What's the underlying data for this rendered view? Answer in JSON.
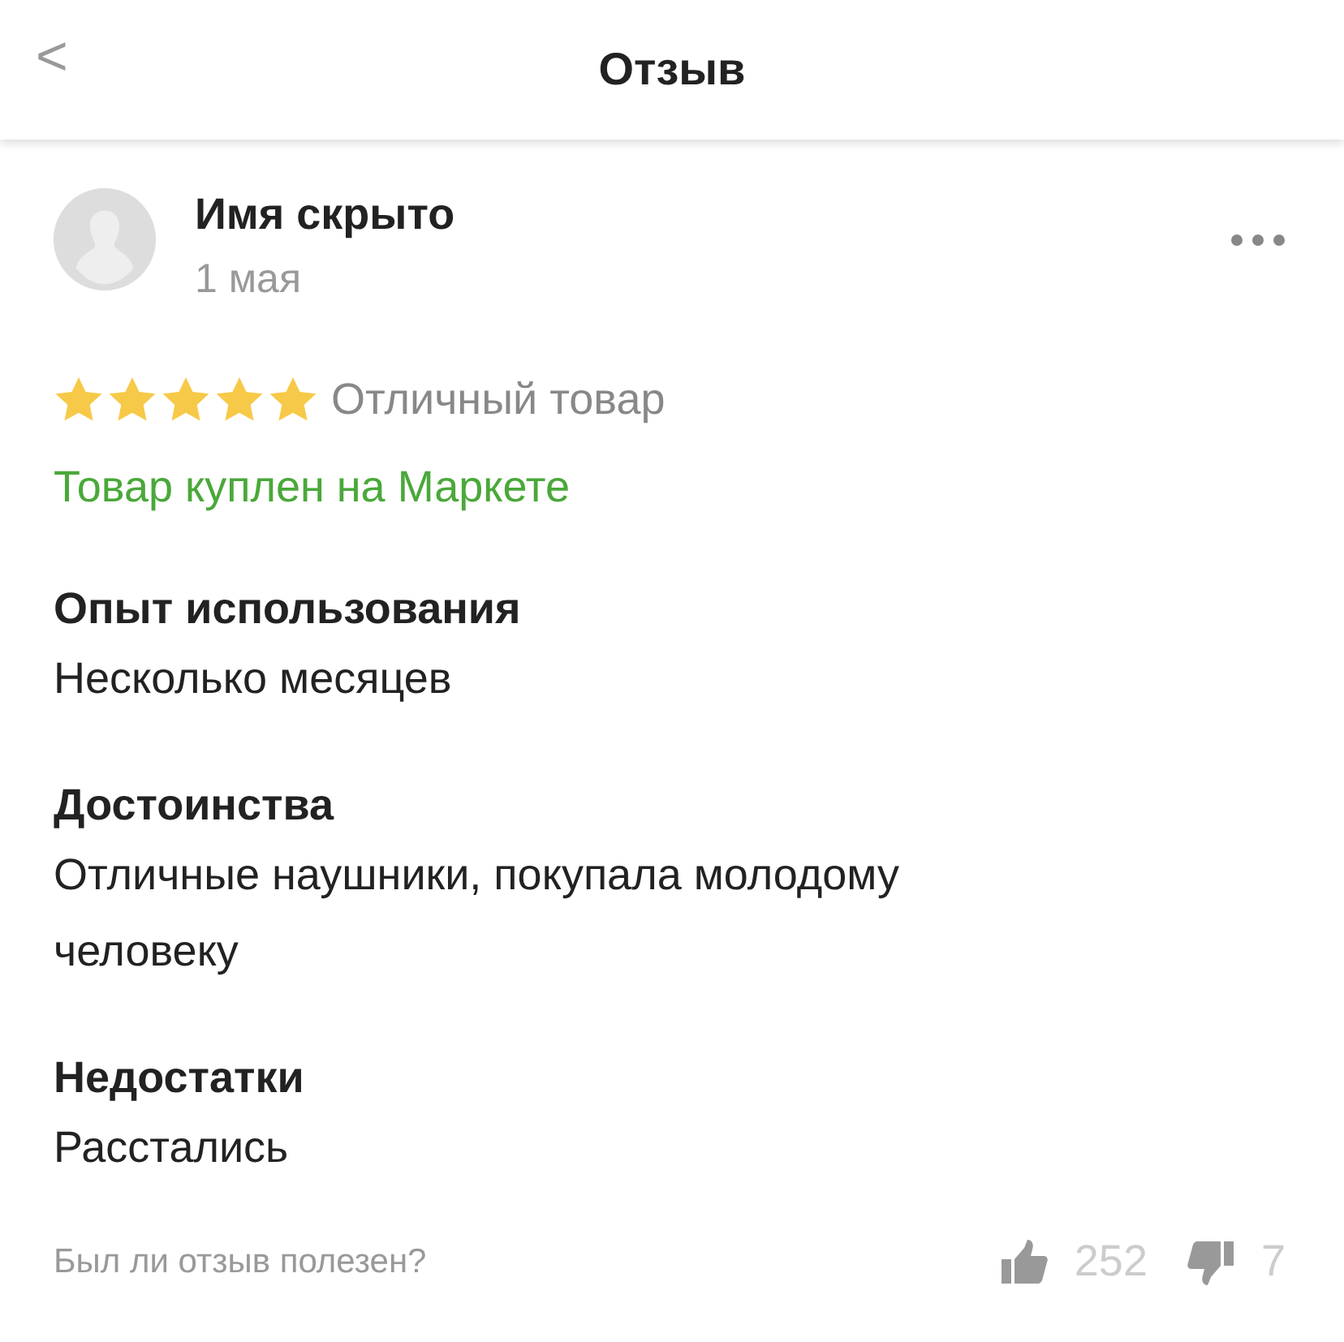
{
  "header": {
    "back": "<",
    "title": "Отзыв"
  },
  "review": {
    "author": "Имя скрыто",
    "date": "1 мая",
    "stars": 5,
    "rating_text": "Отличный товар",
    "purchase_note": "Товар куплен на Маркете",
    "sections": [
      {
        "heading": "Опыт использования",
        "text": "Несколько месяцев"
      },
      {
        "heading": "Достоинства",
        "text": "Отличные наушники, покупала молодому человеку"
      },
      {
        "heading": "Недостатки",
        "text": "Расстались"
      }
    ]
  },
  "footer": {
    "question": "Был ли отзыв полезен?",
    "likes": "252",
    "dislikes": "7"
  }
}
